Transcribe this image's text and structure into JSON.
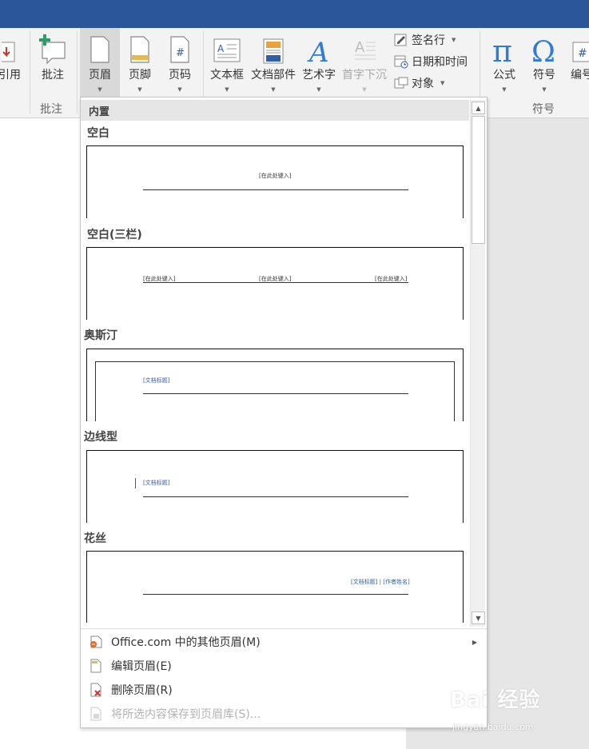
{
  "ribbon": {
    "partial_left_label": "引用",
    "comment_button": "批注",
    "comment_group": "批注",
    "header_button": "页眉",
    "footer_button": "页脚",
    "page_number_button": "页码",
    "textbox_button": "文本框",
    "quickparts_button": "文档部件",
    "wordart_button": "艺术字",
    "dropcap_button": "首字下沉",
    "signature_line": "签名行",
    "datetime": "日期和时间",
    "object": "对象",
    "equation_button": "公式",
    "symbol_button": "符号",
    "numbering_partial": "编号",
    "symbols_group": "符号"
  },
  "gallery": {
    "section_header": "内置",
    "items": [
      {
        "title": "空白",
        "placeholders": [
          "[在此处键入]"
        ]
      },
      {
        "title": "空白(三栏)",
        "placeholders": [
          "[在此处键入]",
          "[在此处键入]",
          "[在此处键入]"
        ]
      },
      {
        "title": "奥斯汀",
        "placeholders": [
          "[文档标题]"
        ]
      },
      {
        "title": "边线型",
        "placeholders": [
          "[文档标题]"
        ]
      },
      {
        "title": "花丝",
        "placeholders": [
          "[文档标题] | [作者姓名]"
        ]
      }
    ]
  },
  "menu": {
    "more_headers": "Office.com 中的其他页眉(M)",
    "edit_header": "编辑页眉(E)",
    "remove_header": "删除页眉(R)",
    "save_selection": "将所选内容保存到页眉库(S)..."
  },
  "watermark": {
    "brand": "Bai 经验",
    "url": "jingyan.baidu.com"
  }
}
